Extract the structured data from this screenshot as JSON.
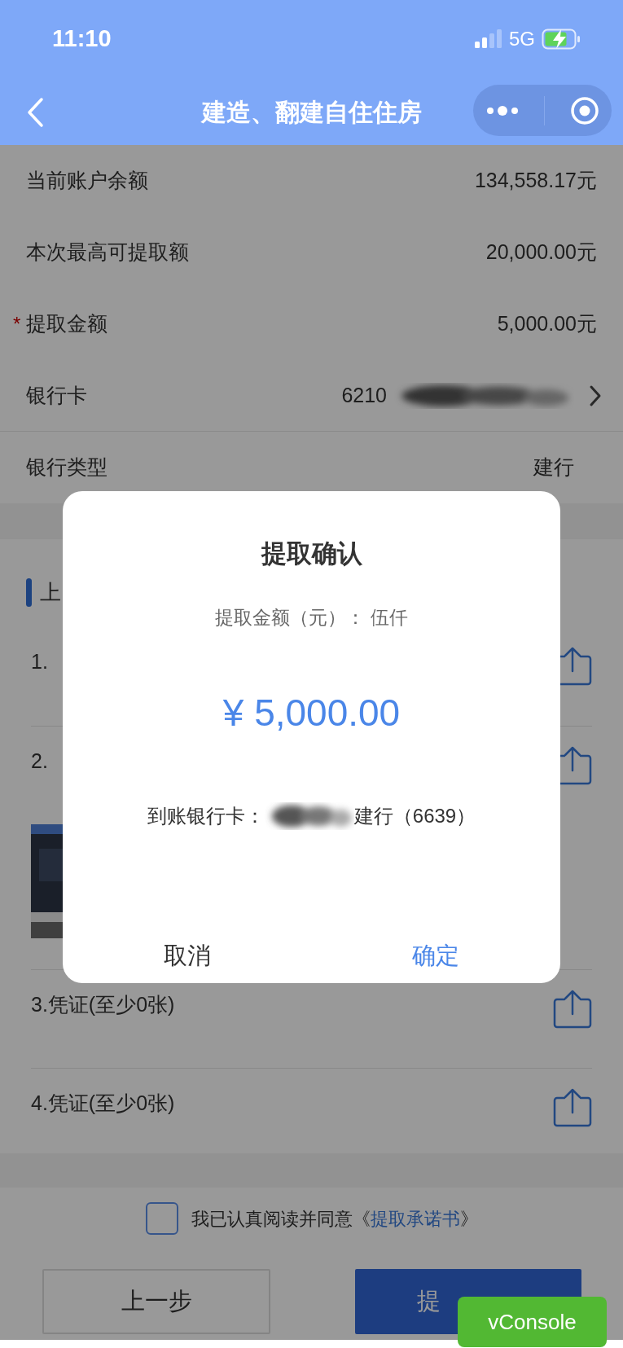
{
  "status_bar": {
    "time": "11:10",
    "network": "5G"
  },
  "nav": {
    "title": "建造、翻建自住住房"
  },
  "fields": [
    {
      "label": "当前账户余额",
      "value": "134,558.17元",
      "kind": "text"
    },
    {
      "label": "本次最高可提取额",
      "value": "20,000.00元",
      "kind": "text"
    },
    {
      "label": "提取金额",
      "value": "5,000.00元",
      "kind": "text",
      "required_mark": "*"
    },
    {
      "label": "银行卡",
      "value": "6210",
      "kind": "link",
      "redacted": true
    },
    {
      "label": "银行类型",
      "value": "建行",
      "kind": "text"
    }
  ],
  "upload_section": {
    "title": "上",
    "items": [
      {
        "label": "1."
      },
      {
        "label": "2."
      },
      {
        "label": "3.凭证(至少0张)"
      },
      {
        "label": "4.凭证(至少0张)"
      }
    ]
  },
  "agreement": {
    "checked": false,
    "text": "我已认真阅读并同意《",
    "link": "提取承诺书",
    "suffix": "》"
  },
  "buttons": [
    {
      "label": "上一步",
      "kind": "secondary"
    },
    {
      "label": "提",
      "kind": "primary"
    }
  ],
  "dialog": {
    "title": "提取确认",
    "amount_words": "提取金额（元）： 伍仟",
    "amount": "¥ 5,000.00",
    "bank_label": "到账银行卡：",
    "bank_redacted": true,
    "bank_value": "建行（6639）",
    "buttons": [
      {
        "label": "取消",
        "kind": "cancel"
      },
      {
        "label": "确定",
        "kind": "confirm"
      }
    ]
  },
  "vconsole": {
    "label": "vConsole"
  }
}
